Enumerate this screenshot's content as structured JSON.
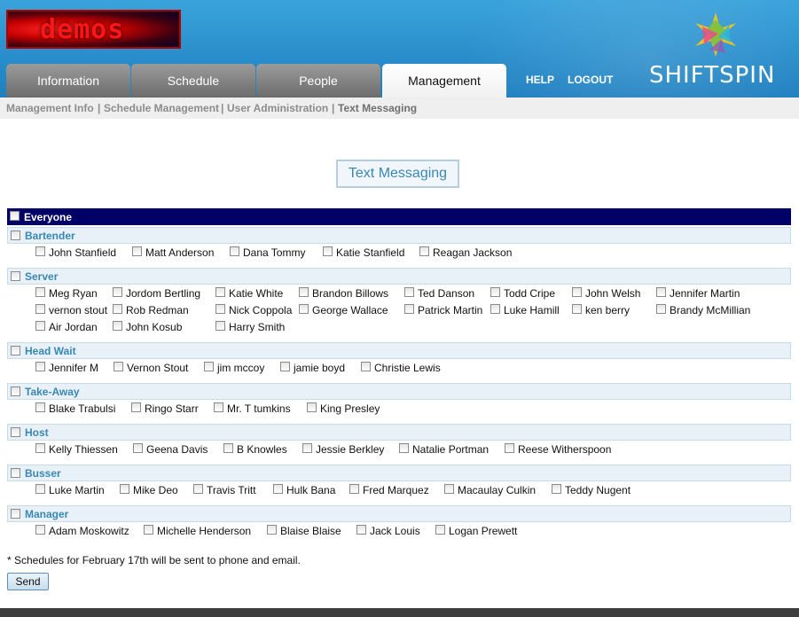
{
  "logo": {
    "text": "demos"
  },
  "brand": {
    "name": "SHIFTSPIN",
    "icon": "shiftspin-star-icon"
  },
  "tabs": [
    {
      "label": "Information",
      "active": false
    },
    {
      "label": "Schedule",
      "active": false
    },
    {
      "label": "People",
      "active": false
    },
    {
      "label": "Management",
      "active": true
    }
  ],
  "header_links": {
    "help": "HELP",
    "logout": "LOGOUT"
  },
  "subnav": {
    "items": [
      "Management Info",
      "Schedule Management",
      "User Administration",
      "Text Messaging"
    ],
    "separator": "|",
    "active": "Text Messaging"
  },
  "page_title": "Text Messaging",
  "everyone_label": "Everyone",
  "groups": [
    {
      "name": "Bartender",
      "people": [
        "John Stanfield",
        "Matt Anderson",
        "Dana Tommy",
        "Katie Stanfield",
        "Reagan Jackson"
      ]
    },
    {
      "name": "Server",
      "people": [
        "Meg Ryan",
        "Jordom Bertling",
        "Katie White",
        "Brandon Billows",
        "Ted Danson",
        "Todd Cripe",
        "John Welsh",
        "Jennifer Martin",
        "vernon stout",
        "Rob Redman",
        "Nick Coppola",
        "George Wallace",
        "Patrick Martin",
        "Luke Hamill",
        "ken berry",
        "Brandy McMillian",
        "Air Jordan",
        "John Kosub",
        "Harry Smith"
      ]
    },
    {
      "name": "Head Wait",
      "people": [
        "Jennifer M",
        "Vernon Stout",
        "jim mccoy",
        "jamie boyd",
        "Christie Lewis"
      ]
    },
    {
      "name": "Take-Away",
      "people": [
        "Blake Trabulsi",
        "Ringo Starr",
        "Mr. T tumkins",
        "King Presley"
      ]
    },
    {
      "name": "Host",
      "people": [
        "Kelly Thiessen",
        "Geena Davis",
        "B Knowles",
        "Jessie Berkley",
        "Natalie Portman",
        "Reese Witherspoon"
      ]
    },
    {
      "name": "Busser",
      "people": [
        "Luke Martin",
        "Mike Deo",
        "Travis Tritt",
        "Hulk Bana",
        "Fred Marquez",
        "Macaulay Culkin",
        "Teddy Nugent"
      ]
    },
    {
      "name": "Manager",
      "people": [
        "Adam Moskowitz",
        "Michelle Henderson",
        "Blaise Blaise",
        "Jack Louis",
        "Logan Prewett"
      ]
    }
  ],
  "note": "* Schedules for February 17th will be sent to phone and email.",
  "send_label": "Send"
}
